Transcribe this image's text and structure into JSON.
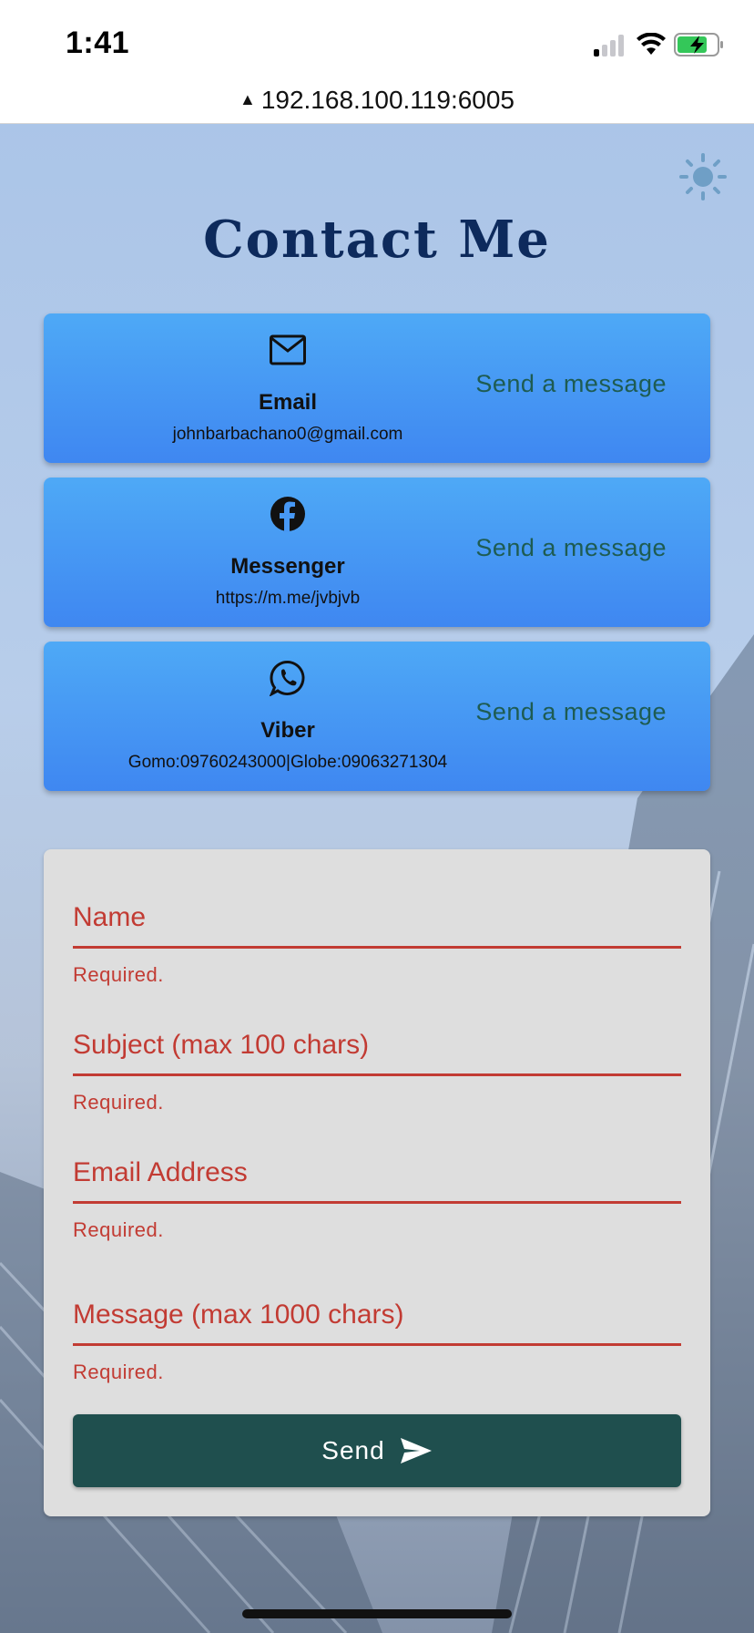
{
  "status_bar": {
    "time": "1:41",
    "icons": [
      "signal-icon",
      "wifi-icon",
      "battery-charging-icon"
    ]
  },
  "browser": {
    "address_warning_icon": "warning-icon",
    "url": "192.168.100.119:6005"
  },
  "page": {
    "theme_toggle_icon": "sun-icon",
    "title": "Contact Me"
  },
  "contacts": [
    {
      "icon": "mail-icon",
      "title": "Email",
      "detail": "johnbarbachano0@gmail.com",
      "action": "Send a message"
    },
    {
      "icon": "facebook-icon",
      "title": "Messenger",
      "detail": "https://m.me/jvbjvb",
      "action": "Send a message"
    },
    {
      "icon": "whatsapp-icon",
      "title": "Viber",
      "detail": "Gomo:09760243000|Globe:09063271304",
      "action": "Send a message"
    }
  ],
  "form": {
    "fields": [
      {
        "label": "Name",
        "helper": "Required."
      },
      {
        "label": "Subject (max 100 chars)",
        "helper": "Required."
      },
      {
        "label": "Email Address",
        "helper": "Required."
      },
      {
        "label": "Message (max 1000 chars)",
        "helper": "Required."
      }
    ],
    "send_label": "Send",
    "send_icon": "send-icon"
  },
  "colors": {
    "card_top": "#4ea9f6",
    "card_bottom": "#3f87f1",
    "error": "#c23b33",
    "button": "#1f4f4e",
    "title": "#0d2a5c",
    "action_text": "#1e5c52"
  }
}
